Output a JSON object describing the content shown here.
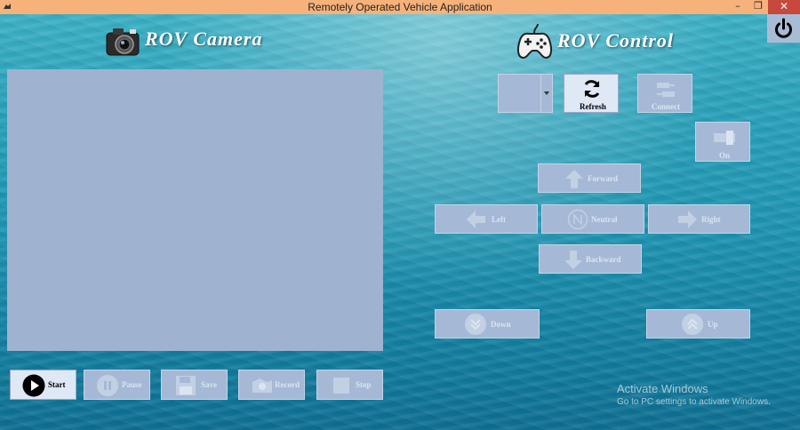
{
  "window": {
    "title": "Remotely Operated Vehicle Application",
    "controls": {
      "minimize": "–",
      "maximize": "❐",
      "close": "✕"
    }
  },
  "camera_section": {
    "heading": "ROV Camera",
    "buttons": {
      "start": "Start",
      "pause": "Pause",
      "save": "Save",
      "record": "Record",
      "stop": "Stop"
    }
  },
  "control_section": {
    "heading": "ROV Control",
    "port_select": {
      "value": ""
    },
    "buttons": {
      "refresh": "Refresh",
      "connect": "Connect",
      "on": "On",
      "forward": "Forward",
      "left": "Left",
      "neutral": "Neutral",
      "right": "Right",
      "backward": "Backward",
      "down": "Down",
      "up": "Up"
    }
  },
  "watermark": {
    "line1": "Activate Windows",
    "line2": "Go to PC settings to activate Windows."
  },
  "colors": {
    "titlebar": "#f6b27a",
    "close": "#c7483c",
    "panel": "#9fb3d0",
    "button_disabled": "#a5b9d6",
    "button_enabled": "#dfe8f5"
  }
}
